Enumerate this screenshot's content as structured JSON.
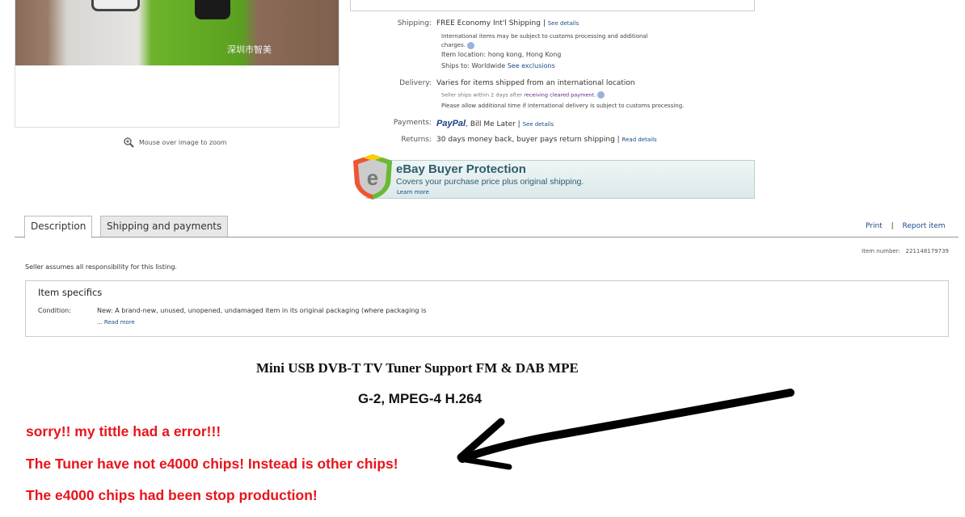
{
  "gallery": {
    "photo_caption_cn": "深圳市智美",
    "zoom_hint": "Mouse over image to zoom"
  },
  "shipping": {
    "label": "Shipping:",
    "value": "FREE  Economy Int'l Shipping | ",
    "link": "See details",
    "note": "International items may be subject to customs processing and additional charges.",
    "location_label": "Item location:",
    "location": "hong kong, Hong Kong",
    "ships_label": "Ships to:",
    "ships": "Worldwide",
    "ships_link": "See exclusions"
  },
  "delivery": {
    "label": "Delivery:",
    "value": "Varies for items shipped from an international location",
    "note_prefix": "Seller ships within 2 days after ",
    "note_link": "receiving cleared payment.",
    "note2": "Please allow additional time if international delivery is subject to customs processing."
  },
  "payments": {
    "label": "Payments:",
    "paypal": "PayPal",
    "value": ", Bill Me Later | ",
    "link": "See details"
  },
  "returns": {
    "label": "Returns:",
    "value": "30 days money back, buyer pays return shipping | ",
    "link": "Read details"
  },
  "buyer_protection": {
    "title": "eBay Buyer Protection",
    "subtitle": "Covers your purchase price plus original shipping.",
    "link": "Learn more"
  },
  "tabs": [
    {
      "label": "Description",
      "active": true
    },
    {
      "label": "Shipping and payments",
      "active": false
    }
  ],
  "actions": {
    "print": "Print",
    "separator": "|",
    "report": "Report item"
  },
  "item_number": {
    "label": "Item number:",
    "value": "221148179739"
  },
  "responsibility": "Seller assumes all responsibility for this listing.",
  "item_specifics": {
    "title": "Item specifics",
    "condition_label": "Condition:",
    "condition_value": "New: A brand-new, unused, unopened, undamaged item in its original packaging (where packaging is",
    "read_more": "Read more",
    "ellipsis": "..."
  },
  "description": {
    "title_line1": "Mini USB DVB-T TV Tuner Support FM & DAB MPE",
    "title_line2": "G-2, MPEG-4 H.264",
    "notes": [
      "sorry!! my tittle had a error!!!",
      "The Tuner have not e4000 chips! Instead is other chips!",
      "The e4000  chips had been stop production!"
    ],
    "note_color": "#e8141b"
  }
}
